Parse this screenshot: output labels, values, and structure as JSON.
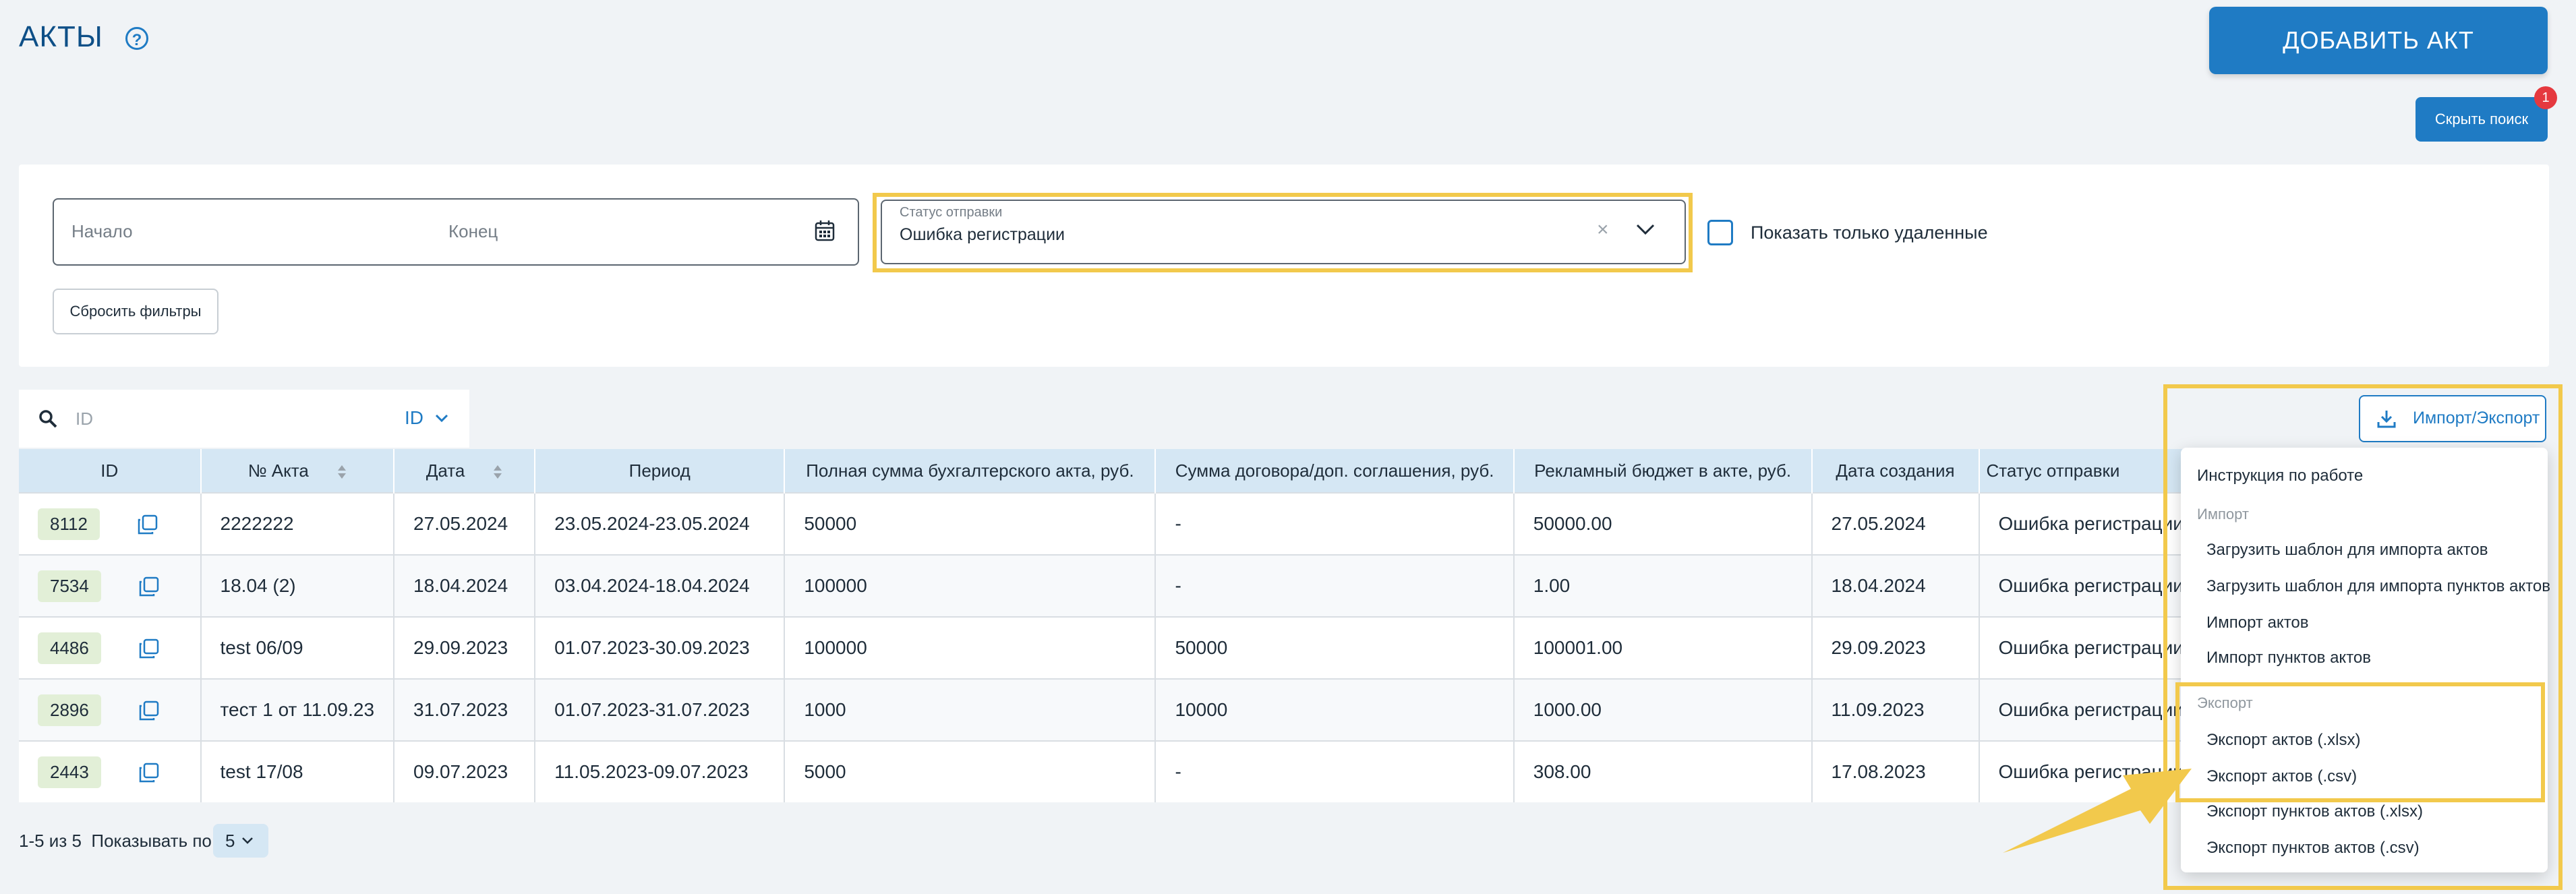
{
  "header": {
    "title": "АКТЫ",
    "help_glyph": "?",
    "add_button": "ДОБАВИТЬ АКТ",
    "hide_search_button": "Скрыть поиск",
    "hide_search_badge": "1"
  },
  "filters": {
    "date_start_placeholder": "Начало",
    "date_end_placeholder": "Конец",
    "status_label": "Статус отправки",
    "status_value": "Ошибка регистрации",
    "show_deleted_label": "Показать только удаленные",
    "reset_button": "Сбросить фильтры"
  },
  "search": {
    "placeholder": "ID",
    "field_selector": "ID"
  },
  "import_export_button": "Импорт/Экспорт",
  "table": {
    "columns": [
      "ID",
      "№ Акта",
      "Дата",
      "Период",
      "Полная сумма бухгалтерского акта, руб.",
      "Сумма договора/доп. соглашения, руб.",
      "Рекламный бюджет в акте, руб.",
      "Дата создания",
      "Статус отправки"
    ],
    "rows": [
      {
        "id": "8112",
        "act": "2222222",
        "date": "27.05.2024",
        "period": "23.05.2024-23.05.2024",
        "full_sum": "50000",
        "contract_sum": "-",
        "budget": "50000.00",
        "created": "27.05.2024",
        "status": "Ошибка регистрации"
      },
      {
        "id": "7534",
        "act": "18.04 (2)",
        "date": "18.04.2024",
        "period": "03.04.2024-18.04.2024",
        "full_sum": "100000",
        "contract_sum": "-",
        "budget": "1.00",
        "created": "18.04.2024",
        "status": "Ошибка регистрации"
      },
      {
        "id": "4486",
        "act": "test 06/09",
        "date": "29.09.2023",
        "period": "01.07.2023-30.09.2023",
        "full_sum": "100000",
        "contract_sum": "50000",
        "budget": "100001.00",
        "created": "29.09.2023",
        "status": "Ошибка регистрации"
      },
      {
        "id": "2896",
        "act": "тест 1 от 11.09.23",
        "date": "31.07.2023",
        "period": "01.07.2023-31.07.2023",
        "full_sum": "1000",
        "contract_sum": "10000",
        "budget": "1000.00",
        "created": "11.09.2023",
        "status": "Ошибка регистрации"
      },
      {
        "id": "2443",
        "act": "test 17/08",
        "date": "09.07.2023",
        "period": "11.05.2023-09.07.2023",
        "full_sum": "5000",
        "contract_sum": "-",
        "budget": "308.00",
        "created": "17.08.2023",
        "status": "Ошибка регистрации"
      }
    ]
  },
  "pagination": {
    "range_text": "1-5 из 5",
    "per_page_label": "Показывать по",
    "per_page_value": "5"
  },
  "menu": {
    "instructions": "Инструкция по работе",
    "import_group": "Импорт",
    "import_items": [
      "Загрузить шаблон для импорта актов",
      "Загрузить шаблон для импорта пунктов актов",
      "Импорт актов",
      "Импорт пунктов актов"
    ],
    "export_group": "Экспорт",
    "export_items": [
      "Экспорт актов (.xlsx)",
      "Экспорт актов (.csv)",
      "Экспорт пунктов актов (.xlsx)",
      "Экспорт пунктов актов (.csv)"
    ]
  },
  "colors": {
    "accent": "#1f7bc4",
    "highlight": "#f2c94c",
    "id_chip": "#e2efd7",
    "header_bg": "#d5e7f4"
  }
}
